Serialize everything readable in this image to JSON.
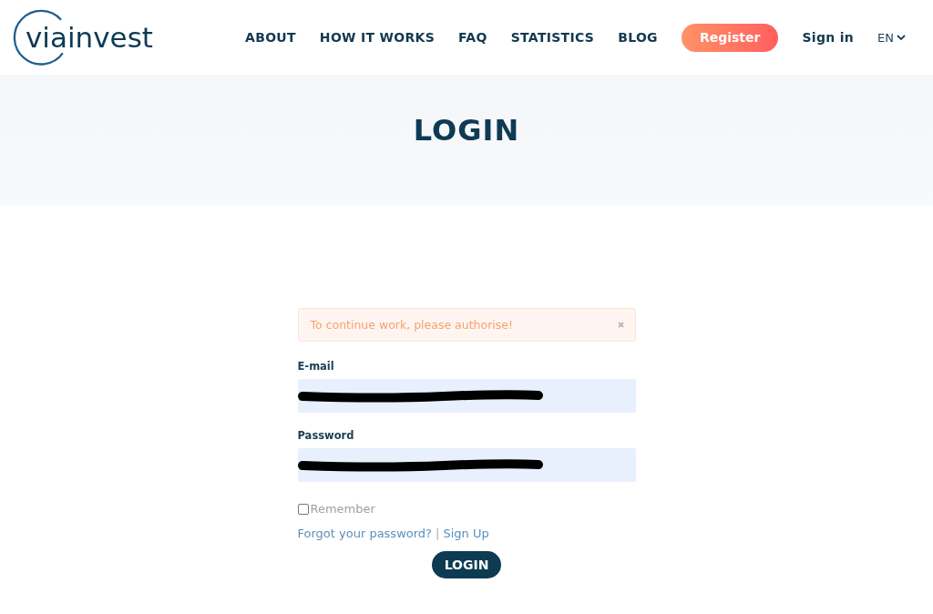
{
  "logo": {
    "text": "viainvest"
  },
  "nav": [
    {
      "label": "ABOUT",
      "kind": "link"
    },
    {
      "label": "HOW IT WORKS",
      "kind": "link"
    },
    {
      "label": "FAQ",
      "kind": "link"
    },
    {
      "label": "STATISTICS",
      "kind": "link"
    },
    {
      "label": "BLOG",
      "kind": "link"
    },
    {
      "label": "Register",
      "kind": "button"
    },
    {
      "label": "Sign in",
      "kind": "link"
    }
  ],
  "language": {
    "label": "EN"
  },
  "page_title": "LOGIN",
  "alert": {
    "message": "To continue work, please authorise!"
  },
  "fields": [
    {
      "label": "E-mail",
      "redacted": true
    },
    {
      "label": "Password",
      "redacted": true
    }
  ],
  "remember": {
    "label": "Remember",
    "checked": false
  },
  "links": [
    {
      "label": "Forgot your password?"
    },
    {
      "label": "Sign Up"
    }
  ],
  "link_separator": "|",
  "submit": "LOGIN"
}
